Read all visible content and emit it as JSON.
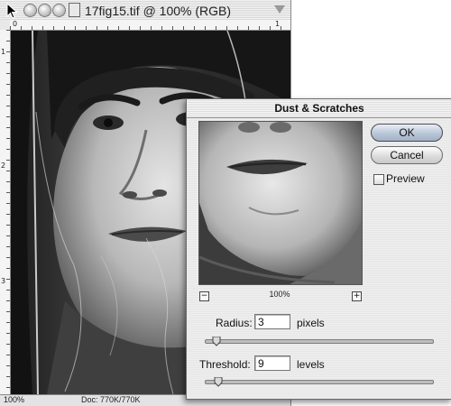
{
  "document": {
    "title": "17fig15.tif @ 100% (RGB)",
    "ruler_h_labels": [
      "0",
      "1"
    ],
    "ruler_v_labels": [
      "1",
      "2",
      "3"
    ],
    "status_zoom": "100%",
    "status_doc": "Doc: 770K/770K"
  },
  "dialog": {
    "title": "Dust & Scratches",
    "ok_label": "OK",
    "cancel_label": "Cancel",
    "preview_label": "Preview",
    "preview_checked": false,
    "zoom_minus": "−",
    "zoom_plus": "+",
    "zoom_level": "100%",
    "radius": {
      "label": "Radius:",
      "value": "3",
      "unit": "pixels",
      "slider_fraction": 0.03
    },
    "threshold": {
      "label": "Threshold:",
      "value": "9",
      "unit": "levels",
      "slider_fraction": 0.04
    }
  },
  "colors": {
    "default_button": "#b9c6d8",
    "dialog_bg": "#ececec"
  },
  "icons": {
    "cursor": "arrow-cursor-icon",
    "close": "close-icon",
    "minimize": "minimize-icon",
    "zoom": "zoom-icon"
  }
}
